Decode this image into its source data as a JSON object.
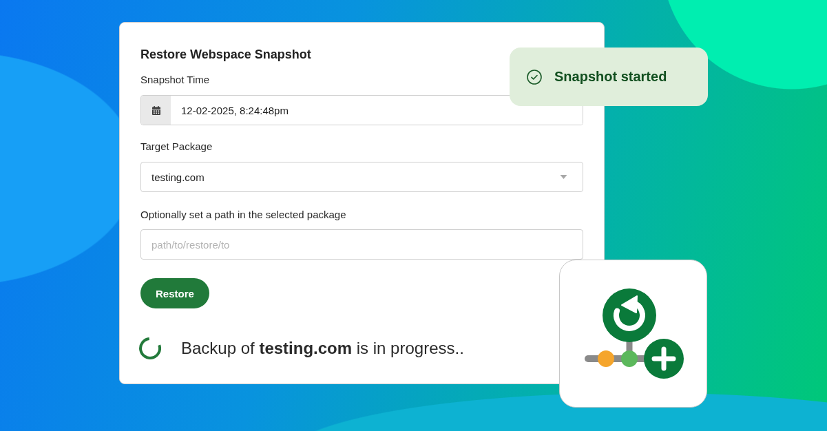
{
  "form": {
    "title": "Restore Webspace Snapshot",
    "fields": [
      {
        "kind": "date",
        "label": "Snapshot Time",
        "value": "12-02-2025, 8:24:48pm"
      },
      {
        "kind": "select",
        "label": "Target Package",
        "value": "testing.com"
      },
      {
        "kind": "text",
        "label": "Optionally set a path in the selected package",
        "placeholder": "path/to/restore/to"
      }
    ],
    "button": "Restore",
    "status": "Backup of **testing.com** is in progress.."
  },
  "toast": {
    "message": "Snapshot started"
  }
}
